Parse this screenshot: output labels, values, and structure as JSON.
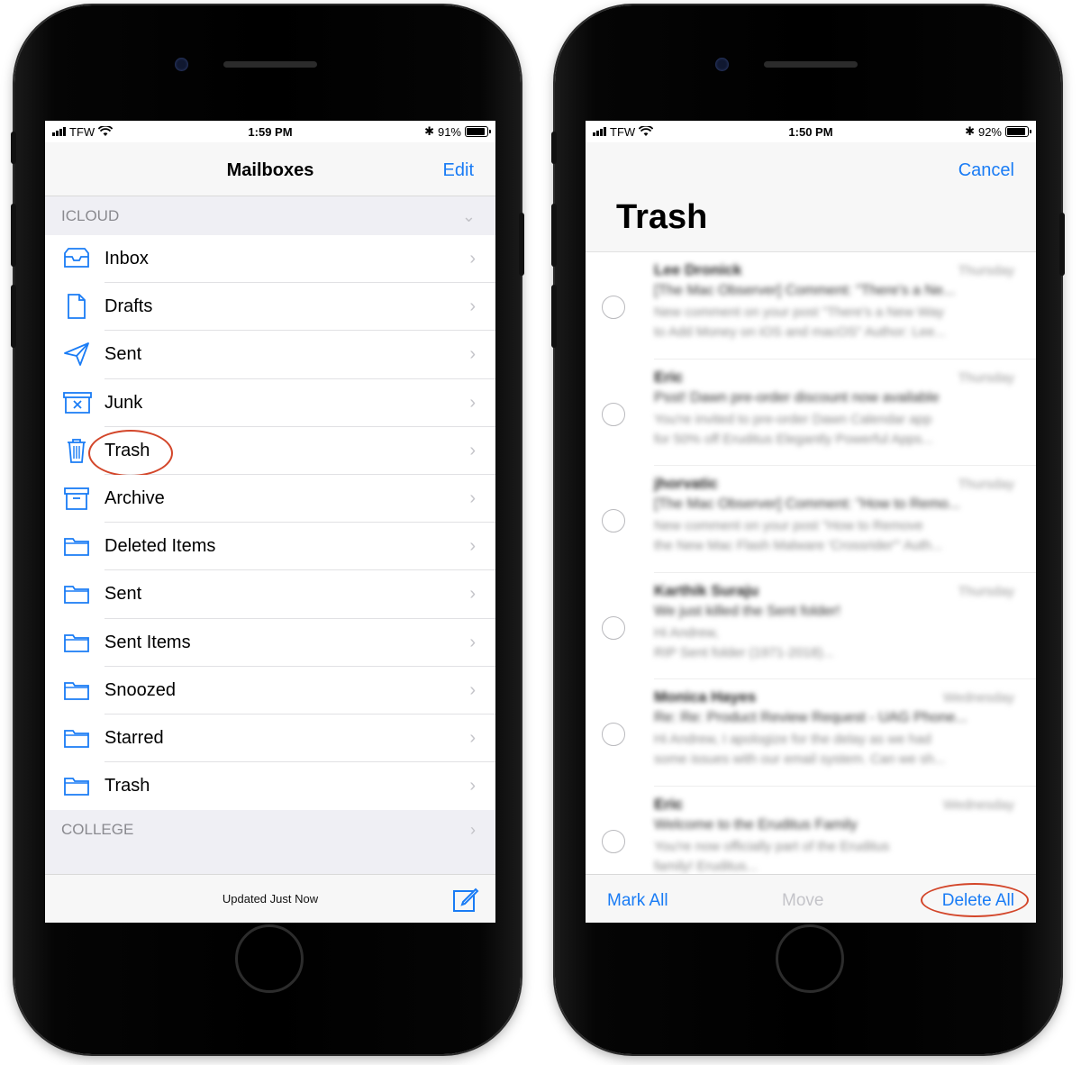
{
  "left_phone": {
    "status": {
      "carrier": "TFW",
      "time": "1:59 PM",
      "battery": "91%",
      "battery_level": 0.91
    },
    "nav": {
      "title": "Mailboxes",
      "edit_label": "Edit"
    },
    "sections": {
      "icloud": "ICLOUD",
      "college": "COLLEGE"
    },
    "mailboxes": [
      {
        "label": "Inbox",
        "icon": "inbox-icon"
      },
      {
        "label": "Drafts",
        "icon": "drafts-icon"
      },
      {
        "label": "Sent",
        "icon": "sent-icon"
      },
      {
        "label": "Junk",
        "icon": "junk-icon"
      },
      {
        "label": "Trash",
        "icon": "trash-icon",
        "highlighted": true
      },
      {
        "label": "Archive",
        "icon": "archive-icon"
      },
      {
        "label": "Deleted Items",
        "icon": "folder-icon"
      },
      {
        "label": "Sent",
        "icon": "folder-icon"
      },
      {
        "label": "Sent Items",
        "icon": "folder-icon"
      },
      {
        "label": "Snoozed",
        "icon": "folder-icon"
      },
      {
        "label": "Starred",
        "icon": "folder-icon"
      },
      {
        "label": "Trash",
        "icon": "folder-icon"
      }
    ],
    "toolbar": {
      "status": "Updated Just Now",
      "compose_icon": "compose-icon"
    }
  },
  "right_phone": {
    "status": {
      "carrier": "TFW",
      "time": "1:50 PM",
      "battery": "92%",
      "battery_level": 0.92
    },
    "nav": {
      "cancel_label": "Cancel",
      "title": "Trash"
    },
    "messages": [
      {
        "sender": "Lee Dronick",
        "date": "Thursday",
        "subject": "[The Mac Observer] Comment: \"There's a Ne...",
        "preview1": "New comment on your post \"There's a New Way",
        "preview2": "to Add Money on iOS and macOS\" Author: Lee..."
      },
      {
        "sender": "Eric",
        "date": "Thursday",
        "subject": "Psst! Dawn pre-order discount now available",
        "preview1": "You're invited to pre-order Dawn Calendar app",
        "preview2": "for 50% off Eruditus Elegantly Powerful Apps..."
      },
      {
        "sender": "jhorvatic",
        "date": "Thursday",
        "subject": "[The Mac Observer] Comment: \"How to Remo...",
        "preview1": "New comment on your post \"How to Remove",
        "preview2": "the New Mac Flash Malware 'Crossrider'\" Auth..."
      },
      {
        "sender": "Karthik Suraju",
        "date": "Thursday",
        "subject": "We just killed the Sent folder!",
        "preview1": "Hi Andrew,",
        "preview2": "RIP Sent folder (1971-2018)..."
      },
      {
        "sender": "Monica Hayes",
        "date": "Wednesday",
        "subject": "Re: Re: Product Review Request - UAG Phone...",
        "preview1": "Hi Andrew, I apologize for the delay as we had",
        "preview2": "some issues with our email system. Can we sh..."
      },
      {
        "sender": "Eric",
        "date": "Wednesday",
        "subject": "Welcome to the Eruditus Family",
        "preview1": "You're now officially part of the Eruditus",
        "preview2": "family! Eruditus..."
      }
    ],
    "toolbar": {
      "mark_all": "Mark All",
      "move": "Move",
      "delete_all": "Delete All"
    }
  },
  "colors": {
    "accent": "#1a7cf5",
    "highlight": "#d3462a"
  }
}
